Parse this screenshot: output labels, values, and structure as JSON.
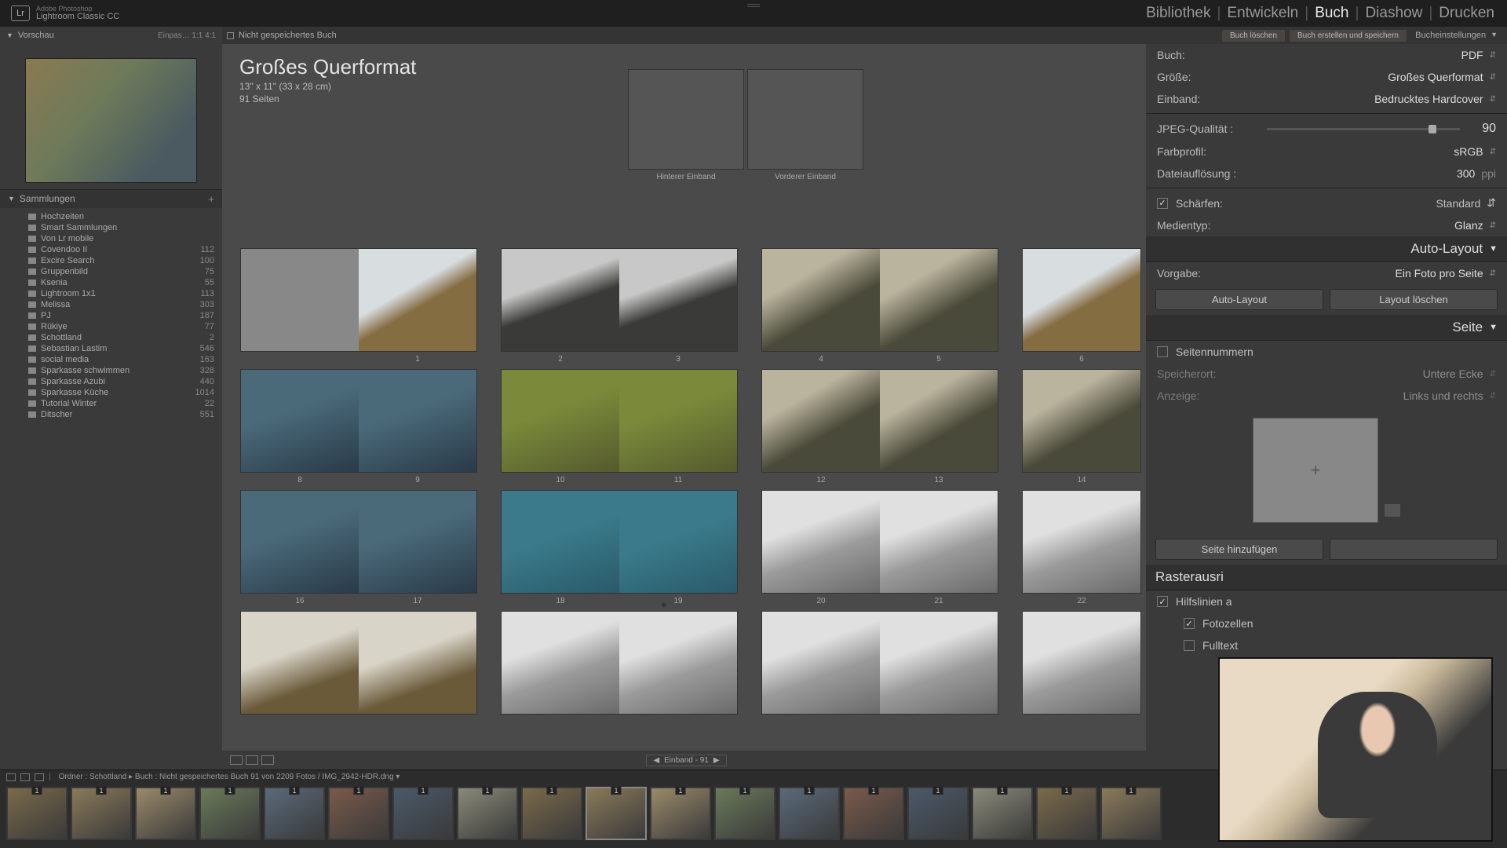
{
  "app": {
    "tagline": "Adobe Photoshop",
    "name": "Lightroom Classic CC"
  },
  "modules": {
    "library": "Bibliothek",
    "develop": "Entwickeln",
    "book": "Buch",
    "slideshow": "Diashow",
    "print": "Drucken"
  },
  "preview_label": "Vorschau",
  "preview_right": "Einpas…   1:1   4:1",
  "doc_status": "Nicht gespeichertes Buch",
  "chips": {
    "delete": "Buch löschen",
    "save": "Buch erstellen und speichern"
  },
  "right_label": "Bucheinstellungen",
  "collections_label": "Sammlungen",
  "collections": [
    {
      "name": "Hochzeiten",
      "cnt": ""
    },
    {
      "name": "Smart Sammlungen",
      "cnt": ""
    },
    {
      "name": "Von Lr mobile",
      "cnt": ""
    },
    {
      "name": "Covendoo II",
      "cnt": "112"
    },
    {
      "name": "Excire Search",
      "cnt": "100"
    },
    {
      "name": "Gruppenbild",
      "cnt": "75"
    },
    {
      "name": "Ksenia",
      "cnt": "55"
    },
    {
      "name": "Lightroom 1x1",
      "cnt": "113"
    },
    {
      "name": "Melissa",
      "cnt": "303"
    },
    {
      "name": "PJ",
      "cnt": "187"
    },
    {
      "name": "Rükiye",
      "cnt": "77"
    },
    {
      "name": "Schottland",
      "cnt": "2"
    },
    {
      "name": "Sebastian Lastim",
      "cnt": "546"
    },
    {
      "name": "social media",
      "cnt": "163"
    },
    {
      "name": "Sparkasse schwimmen",
      "cnt": "328"
    },
    {
      "name": "Sparkasse Azubi",
      "cnt": "440"
    },
    {
      "name": "Sparkasse Küche",
      "cnt": "1014"
    },
    {
      "name": "Tutorial Winter",
      "cnt": "22"
    },
    {
      "name": "Ditscher",
      "cnt": "551"
    }
  ],
  "book": {
    "title": "Großes Querformat",
    "dims": "13\" x 11\" (33 x 28 cm)",
    "pages": "91 Seiten"
  },
  "cover_back": "Hinterer Einband",
  "cover_front": "Vorderer Einband",
  "pageNums": [
    "1",
    "2",
    "3",
    "4",
    "5",
    "6",
    "8",
    "9",
    "10",
    "11",
    "12",
    "13",
    "14",
    "16",
    "17",
    "18",
    "19",
    "20",
    "21",
    "22"
  ],
  "footer_nav": "Einband - 91",
  "settings": {
    "buch": {
      "k": "Buch:",
      "v": "PDF"
    },
    "groesse": {
      "k": "Größe:",
      "v": "Großes Querformat"
    },
    "einband": {
      "k": "Einband:",
      "v": "Bedrucktes Hardcover"
    },
    "jpeg": {
      "k": "JPEG-Qualität :",
      "v": "90"
    },
    "farbprofil": {
      "k": "Farbprofil:",
      "v": "sRGB"
    },
    "aufloesung": {
      "k": "Dateiauflösung :",
      "v": "300",
      "unit": "ppi"
    },
    "schaerfen": {
      "k": "Schärfen:",
      "v": "Standard"
    },
    "medientyp": {
      "k": "Medientyp:",
      "v": "Glanz"
    }
  },
  "autolayout": {
    "hdr": "Auto-Layout",
    "preset": {
      "k": "Vorgabe:",
      "v": "Ein Foto pro Seite"
    },
    "btn1": "Auto-Layout",
    "btn2": "Layout löschen"
  },
  "seite": {
    "hdr": "Seite",
    "nummern": "Seitennummern",
    "speicherort": {
      "k": "Speicherort:",
      "v": "Untere Ecke"
    },
    "anzeige": {
      "k": "Anzeige:",
      "v": "Links und rechts"
    },
    "btn": "Seite hinzufügen"
  },
  "raster": {
    "hdr": "Rasterausri",
    "hilfs": "Hilfslinien a",
    "fotozellen": "Fotozellen",
    "fulltext": "Fulltext"
  },
  "filmstrip_path": "Ordner : Schottland   ▸   Buch : Nicht gespeichertes Buch    91 von 2209 Fotos /  IMG_2942-HDR.dng ▾"
}
